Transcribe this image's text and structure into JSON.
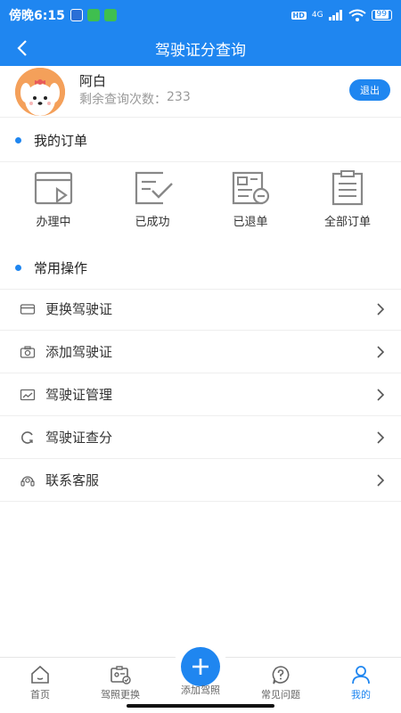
{
  "status_bar": {
    "time": "傍晚6:15",
    "network": "4G",
    "hd": "HD",
    "battery": "99"
  },
  "nav": {
    "title": "驾驶证分查询"
  },
  "profile": {
    "name": "阿白",
    "count_label": "剩余查询次数：",
    "count_value": "233",
    "logout_label": "退出"
  },
  "orders": {
    "title": "我的订单",
    "items": [
      {
        "label": "办理中",
        "icon": "processing-window-icon"
      },
      {
        "label": "已成功",
        "icon": "success-check-icon"
      },
      {
        "label": "已退单",
        "icon": "refund-document-icon"
      },
      {
        "label": "全部订单",
        "icon": "clipboard-list-icon"
      }
    ]
  },
  "operations": {
    "title": "常用操作",
    "items": [
      {
        "label": "更换驾驶证",
        "icon": "card-icon"
      },
      {
        "label": "添加驾驶证",
        "icon": "camera-icon"
      },
      {
        "label": "驾驶证管理",
        "icon": "chart-card-icon"
      },
      {
        "label": "驾驶证查分",
        "icon": "refresh-icon"
      },
      {
        "label": "联系客服",
        "icon": "headset-icon"
      }
    ]
  },
  "tab_bar": {
    "items": [
      {
        "label": "首页",
        "icon": "home-icon"
      },
      {
        "label": "驾照更换",
        "icon": "license-swap-icon"
      },
      {
        "label": "添加驾照",
        "icon": "plus-icon"
      },
      {
        "label": "常见问题",
        "icon": "help-icon"
      },
      {
        "label": "我的",
        "icon": "user-icon"
      }
    ],
    "active_index": 4
  },
  "colors": {
    "accent": "#1f86f0",
    "divider": "#eeeeee",
    "muted_text": "#999999"
  }
}
